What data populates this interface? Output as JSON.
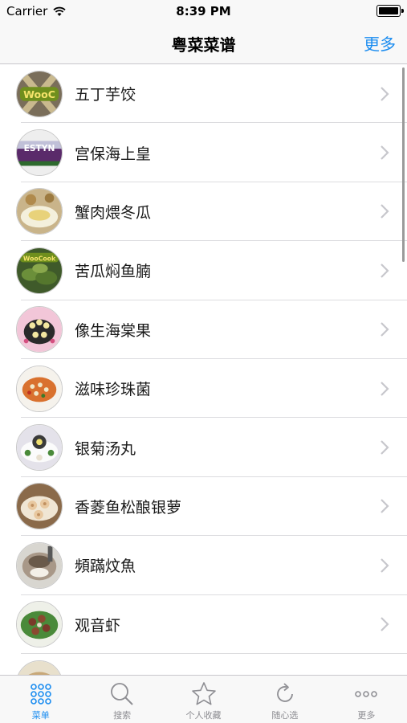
{
  "status_bar": {
    "carrier": "Carrier",
    "time": "8:39 PM"
  },
  "nav": {
    "title": "粤菜菜谱",
    "more": "更多"
  },
  "recipes": [
    {
      "name": "五丁芋饺"
    },
    {
      "name": "宫保海上皇"
    },
    {
      "name": "蟹肉煨冬瓜"
    },
    {
      "name": "苦瓜焖鱼腩"
    },
    {
      "name": "像生海棠果"
    },
    {
      "name": "滋味珍珠菌"
    },
    {
      "name": "银菊汤丸"
    },
    {
      "name": "香菱鱼松酿银萝"
    },
    {
      "name": "頻蹣炆魚"
    },
    {
      "name": "观音虾"
    }
  ],
  "tabs": [
    {
      "label": "菜单",
      "icon": "grid-icon",
      "active": true
    },
    {
      "label": "搜索",
      "icon": "search-icon",
      "active": false
    },
    {
      "label": "个人收藏",
      "icon": "star-icon",
      "active": false
    },
    {
      "label": "随心选",
      "icon": "refresh-icon",
      "active": false
    },
    {
      "label": "更多",
      "icon": "more-icon",
      "active": false
    }
  ],
  "colors": {
    "accent": "#1a8cf0",
    "inactive": "#8e8e93"
  }
}
